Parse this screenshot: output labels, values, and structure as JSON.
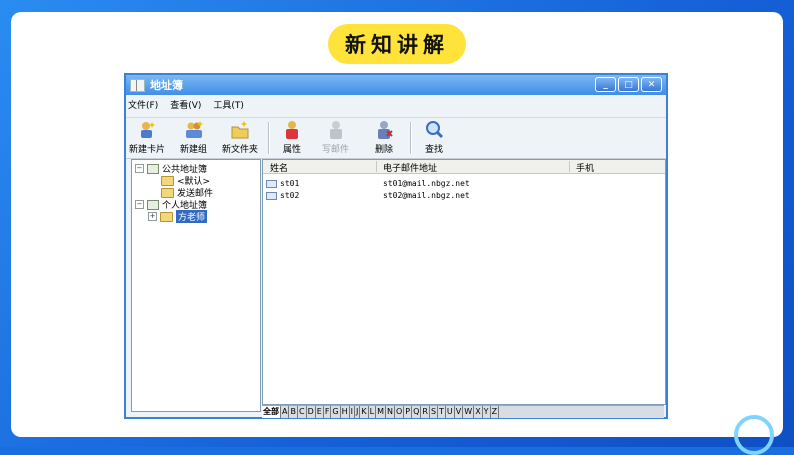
{
  "slide": {
    "title": "新知讲解"
  },
  "window": {
    "title": "地址簿",
    "controls": {
      "minimize": "_",
      "maximize": "□",
      "close": "✕"
    }
  },
  "menu": [
    "文件(F)",
    "查看(V)",
    "工具(T)"
  ],
  "toolbar": [
    {
      "label": "新建卡片",
      "icon": "new-card-icon",
      "enabled": true
    },
    {
      "label": "新建组",
      "icon": "new-group-icon",
      "enabled": true
    },
    {
      "label": "新文件夹",
      "icon": "new-folder-icon",
      "enabled": true
    },
    {
      "label": "属性",
      "icon": "properties-icon",
      "enabled": true
    },
    {
      "label": "写邮件",
      "icon": "write-mail-icon",
      "enabled": false
    },
    {
      "label": "删除",
      "icon": "delete-icon",
      "enabled": true
    },
    {
      "label": "查找",
      "icon": "find-icon",
      "enabled": true
    }
  ],
  "tree": {
    "public_root": "公共地址簿",
    "public_children": [
      "<默认>",
      "发送邮件"
    ],
    "personal_root": "个人地址簿",
    "personal_children": [
      "方老师"
    ]
  },
  "list": {
    "columns": [
      "姓名",
      "电子邮件地址",
      "手机"
    ],
    "rows": [
      {
        "name": "st01",
        "email": "st01@mail.nbgz.net",
        "mobile": ""
      },
      {
        "name": "st02",
        "email": "st02@mail.nbgz.net",
        "mobile": ""
      }
    ]
  },
  "alpha_tabs": [
    "全部",
    "A",
    "B",
    "C",
    "D",
    "E",
    "F",
    "G",
    "H",
    "I",
    "J",
    "K",
    "L",
    "M",
    "N",
    "O",
    "P",
    "Q",
    "R",
    "S",
    "T",
    "U",
    "V",
    "W",
    "X",
    "Y",
    "Z"
  ],
  "colors": {
    "selection": "#316ac5",
    "titlebar": "#3f8ee6",
    "title_pill": "#ffe23a"
  }
}
